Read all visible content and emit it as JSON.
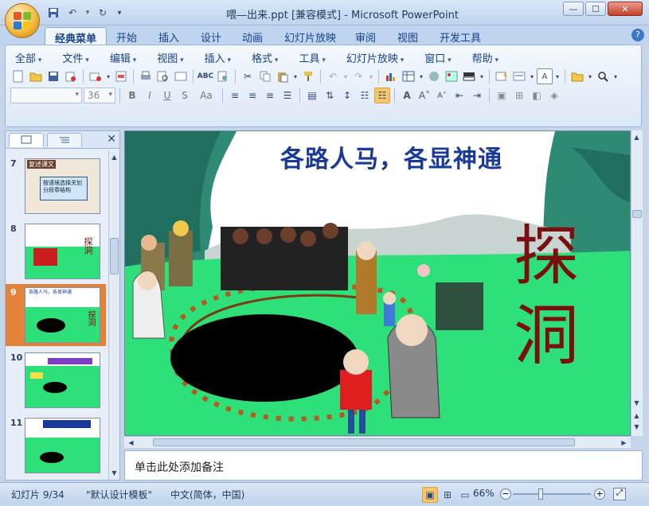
{
  "window": {
    "title": "喂—出来.ppt [兼容模式] - Microsoft PowerPoint",
    "minimize": "▭",
    "maximize": "☐",
    "close": "✕"
  },
  "quick_access": [
    "save-icon",
    "undo-icon",
    "redo-icon",
    "customize-icon"
  ],
  "tabs": [
    "经典菜单",
    "开始",
    "插入",
    "设计",
    "动画",
    "幻灯片放映",
    "审阅",
    "视图",
    "开发工具"
  ],
  "active_tab": "经典菜单",
  "menus": [
    "全部",
    "文件",
    "编辑",
    "视图",
    "插入",
    "格式",
    "工具",
    "幻灯片放映",
    "窗口",
    "帮助"
  ],
  "font": {
    "name": "",
    "size": "36"
  },
  "format_buttons": {
    "bold": "B",
    "italic": "I",
    "underline": "U",
    "shadow": "S",
    "case": "Aa"
  },
  "slides": [
    {
      "num": "7",
      "caption": "复述课文",
      "inner": "按语境选择关划分段章结构"
    },
    {
      "num": "8",
      "caption": "",
      "inner": "探洞"
    },
    {
      "num": "9",
      "caption": "",
      "inner": "各路人马，各显神通",
      "selected": true
    },
    {
      "num": "10",
      "caption": "",
      "inner": ""
    },
    {
      "num": "11",
      "caption": "",
      "inner": ""
    }
  ],
  "slide": {
    "title": "各路人马，各显神通",
    "side_text": [
      "探",
      "洞"
    ]
  },
  "notes_placeholder": "单击此处添加备注",
  "status": {
    "slide_pos": "幻灯片 9/34",
    "template": "\"默认设计模板\"",
    "language": "中文(简体，中国)",
    "zoom": "66%"
  },
  "colors": {
    "accent": "#15428b",
    "title_blue": "#1a3a9a",
    "side_text_red": "#7a0f0f",
    "grass": "#2ee07a",
    "selected_thumb": "#e4823a"
  }
}
